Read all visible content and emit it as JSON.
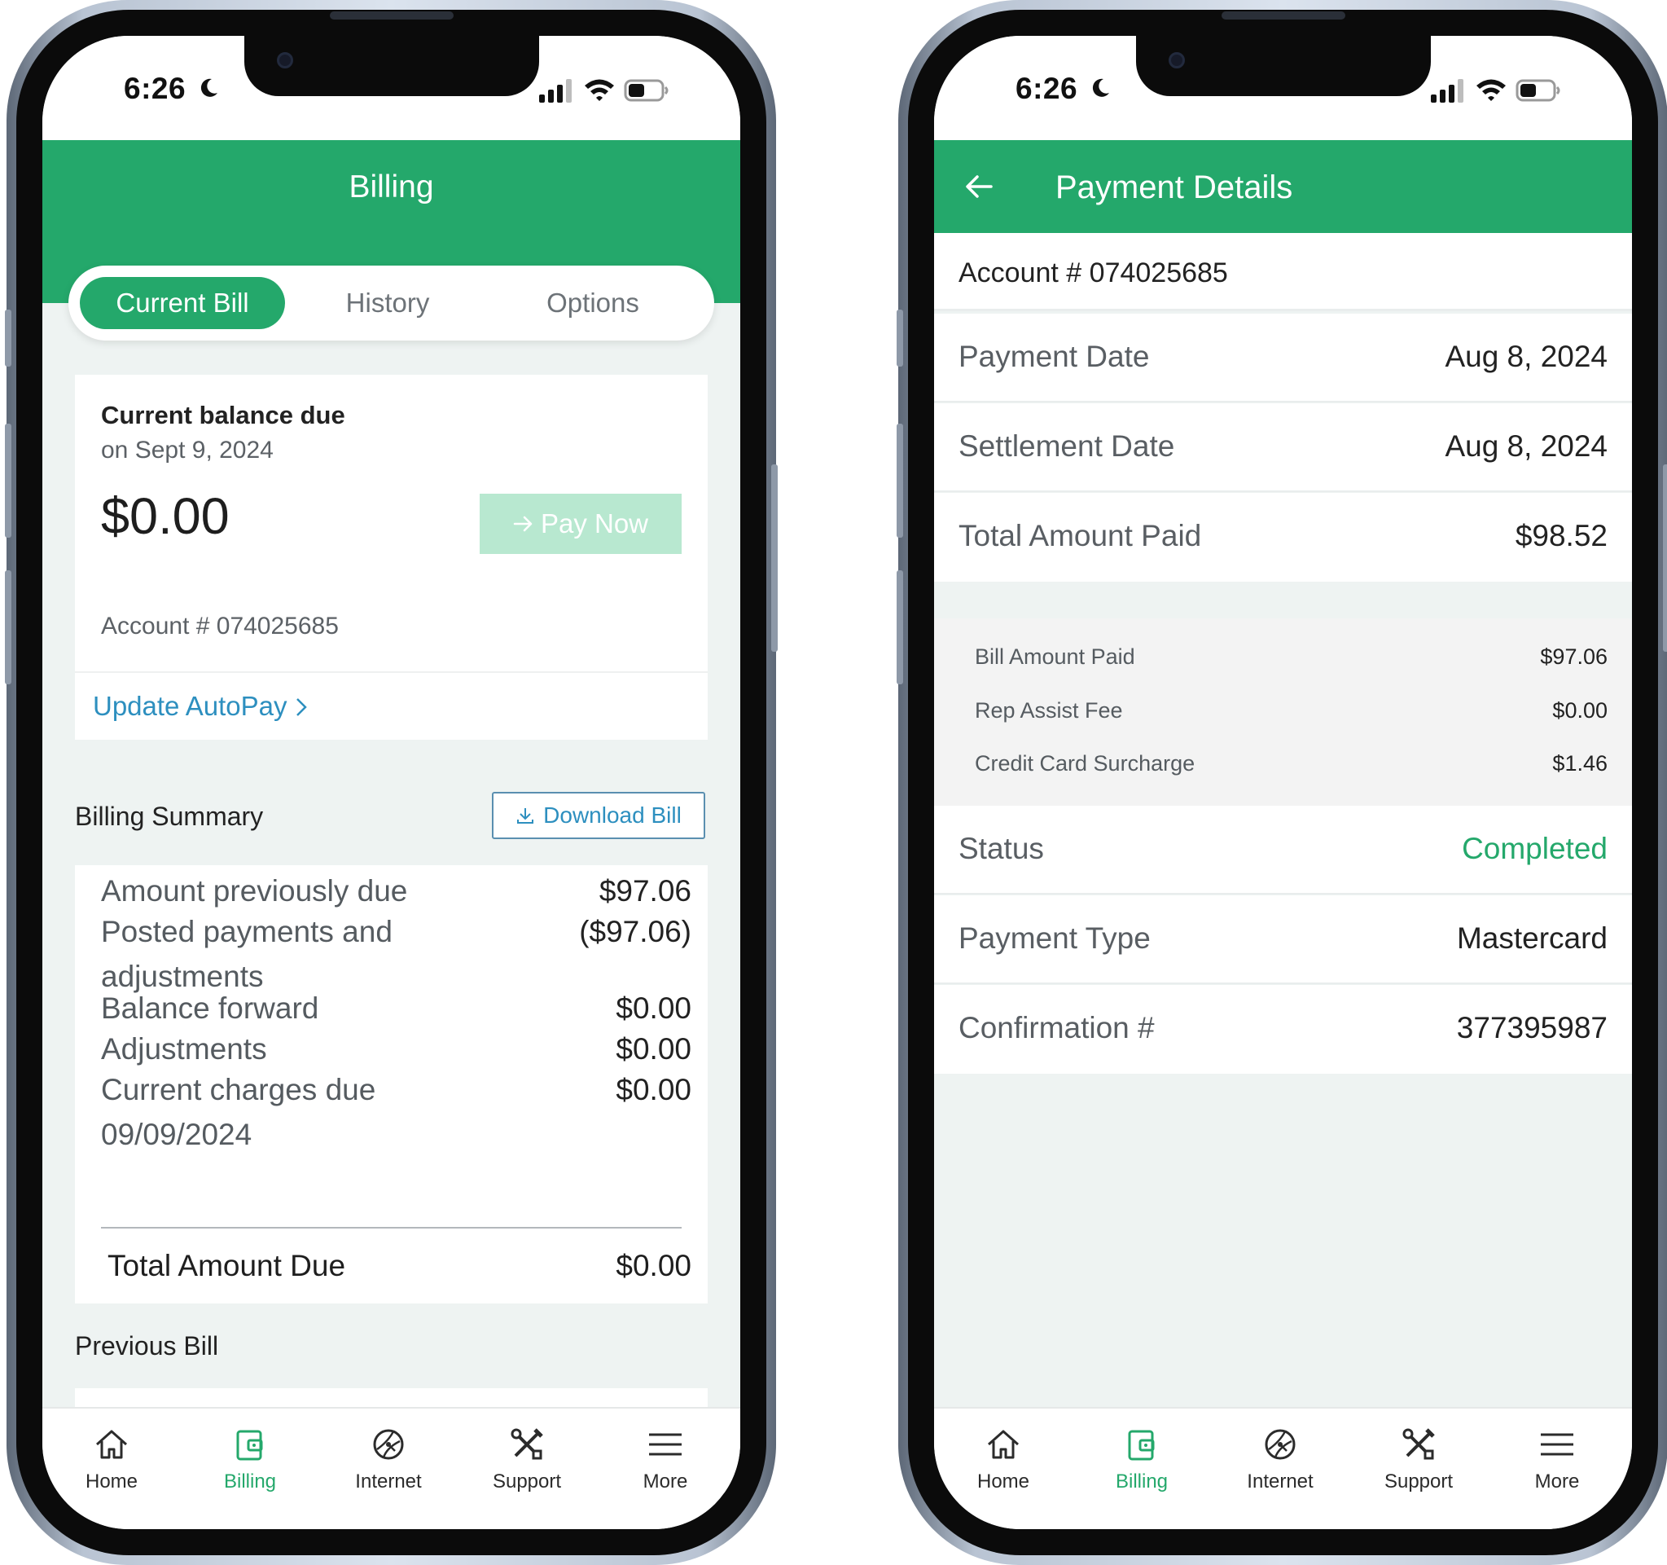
{
  "status_bar": {
    "time": "6:26"
  },
  "left_screen": {
    "header_title": "Billing",
    "tabs": [
      {
        "label": "Current Bill",
        "active": true
      },
      {
        "label": "History",
        "active": false
      },
      {
        "label": "Options",
        "active": false
      }
    ],
    "balance": {
      "title": "Current balance due",
      "due_date": "on Sept 9, 2024",
      "amount": "$0.00",
      "pay_button": "Pay Now",
      "account": "Account # 074025685",
      "autopay_link": "Update AutoPay"
    },
    "billing_summary": {
      "label": "Billing Summary",
      "download_button": "Download Bill",
      "rows": [
        {
          "label": "Amount previously due",
          "value": "$97.06"
        },
        {
          "label": "Posted payments and adjustments",
          "value": "($97.06)"
        },
        {
          "label": "Balance forward",
          "value": "$0.00"
        },
        {
          "label": "Adjustments",
          "value": "$0.00"
        },
        {
          "label": "Current charges due 09/09/2024",
          "value": "$0.00"
        }
      ],
      "total_label": "Total Amount Due",
      "total_value": "$0.00"
    },
    "previous_bill_label": "Previous Bill"
  },
  "right_screen": {
    "header_title": "Payment Details",
    "account": "Account # 074025685",
    "rows": [
      {
        "label": "Payment Date",
        "value": "Aug 8, 2024"
      },
      {
        "label": "Settlement Date",
        "value": "Aug 8, 2024"
      },
      {
        "label": "Total Amount Paid",
        "value": "$98.52"
      }
    ],
    "breakdown": [
      {
        "label": "Bill Amount Paid",
        "value": "$97.06"
      },
      {
        "label": "Rep Assist Fee",
        "value": "$0.00"
      },
      {
        "label": "Credit Card Surcharge",
        "value": "$1.46"
      }
    ],
    "rows_after": [
      {
        "label": "Status",
        "value": "Completed"
      },
      {
        "label": "Payment Type",
        "value": "Mastercard"
      },
      {
        "label": "Confirmation #",
        "value": "377395987"
      }
    ]
  },
  "bottom_nav": [
    {
      "label": "Home",
      "icon": "home-icon",
      "active": false
    },
    {
      "label": "Billing",
      "icon": "wallet-icon",
      "active": true
    },
    {
      "label": "Internet",
      "icon": "globe-icon",
      "active": false
    },
    {
      "label": "Support",
      "icon": "tools-icon",
      "active": false
    },
    {
      "label": "More",
      "icon": "menu-icon",
      "active": false
    }
  ],
  "colors": {
    "brand_green": "#24a86b",
    "link_blue": "#2d8fbf",
    "pay_button_disabled": "#b8e8d0",
    "screen_background": "#eef3f2"
  }
}
